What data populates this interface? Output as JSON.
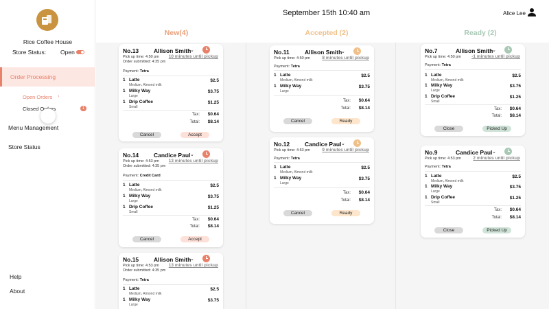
{
  "header": {
    "datetime": "September 15th 10:40 am",
    "user_name": "Alice Lee"
  },
  "sidebar": {
    "store_name": "Rice Coffee House",
    "store_status_label": "Store Status:",
    "store_status_value": "Open",
    "order_processing": "Order Processing",
    "open_orders": "Open Orders",
    "closed_orders": "Closed Orders",
    "closed_orders_count": "1",
    "menu_management": "Menu Management",
    "store_status": "Store Status",
    "help": "Help",
    "about": "About"
  },
  "columns": {
    "new": "New(4)",
    "accepted": "Accepted (2)",
    "ready": "Ready  (2)"
  },
  "colors": {
    "accent": "#e8826b",
    "new": "#e8a07a",
    "accepted": "#f0c08a",
    "ready": "#a9c9b6",
    "clock_new": "#e8826b",
    "clock_accepted": "#f0c08a",
    "clock_ready": "#a9c9b6"
  },
  "labels": {
    "tax": "Tax:",
    "total": "Total:",
    "cancel": "Cancel",
    "accept": "Accept",
    "ready": "Ready",
    "close": "Close",
    "picked_up": "Picked Up"
  },
  "orders": {
    "n13": {
      "number": "No.13",
      "customer": "Allison Smith",
      "pickup": "Pick up time: 4:50 pm",
      "submitted": "Order submitted: 4:35 pm",
      "until": "10 minutes until pickup",
      "payment_label": "Payment:",
      "payment": "Tetra",
      "items": [
        {
          "qty": "1",
          "name": "Latte",
          "mod": "Medium, Almond milk",
          "price": "$2.5"
        },
        {
          "qty": "1",
          "name": "Milky Way",
          "mod": "Large",
          "price": "$3.75"
        },
        {
          "qty": "1",
          "name": "Drip Coffee",
          "mod": "Small",
          "price": "$1.25"
        }
      ],
      "tax": "$0.64",
      "total": "$8.14"
    },
    "n14": {
      "number": "No.14",
      "customer": "Candice Paul",
      "pickup": "Pick up time: 4:53 pm",
      "submitted": "Order submitted: 4:35 pm",
      "until": "13 minutes until pickup",
      "payment_label": "Payment:",
      "payment": "Credit Card",
      "items": [
        {
          "qty": "1",
          "name": "Latte",
          "mod": "Medium, Almond milk",
          "price": "$2.5"
        },
        {
          "qty": "1",
          "name": "Milky Way",
          "mod": "Large",
          "price": "$3.75"
        },
        {
          "qty": "1",
          "name": "Drip Coffee",
          "mod": "Small",
          "price": "$1.25"
        }
      ],
      "tax": "$0.64",
      "total": "$8.14"
    },
    "n15": {
      "number": "No.15",
      "customer": "Allison Smith",
      "pickup": "Pick up time: 4:53 pm",
      "submitted": "Order submitted: 4:35 pm",
      "until": "13 minutes until pickup",
      "payment_label": "Payment:",
      "payment": "Tetra",
      "items": [
        {
          "qty": "1",
          "name": "Latte",
          "mod": "Medium, Almond milk",
          "price": "$2.5"
        },
        {
          "qty": "1",
          "name": "Milky Way",
          "mod": "Large",
          "price": "$3.75"
        }
      ]
    },
    "n11": {
      "number": "No.11",
      "customer": "Allison Smith",
      "pickup": "Pick up time: 4:50 pm",
      "until": "8 minutes until pickup",
      "payment_label": "Payment:",
      "payment": "Tetra",
      "items": [
        {
          "qty": "1",
          "name": "Latte",
          "mod": "Medium, Almond milk",
          "price": "$2.5"
        },
        {
          "qty": "1",
          "name": "Milky Way",
          "mod": "Large",
          "price": "$3.75"
        }
      ],
      "tax": "$0.64",
      "total": "$8.14"
    },
    "n12": {
      "number": "No.12",
      "customer": "Candice Paul",
      "pickup": "Pick up time: 4:53 pm",
      "until": "9 minutes until pickup",
      "payment_label": "Payment:",
      "payment": "Tetra",
      "items": [
        {
          "qty": "1",
          "name": "Latte",
          "mod": "Medium, Almond milk",
          "price": "$2.5"
        },
        {
          "qty": "1",
          "name": "Milky Way",
          "mod": "Large",
          "price": "$3.75"
        }
      ],
      "tax": "$0.64",
      "total": "$8.14"
    },
    "n7": {
      "number": "No.7",
      "customer": "Allison Smith",
      "pickup": "Pick up time: 4:50 pm",
      "until": "-1 minutes until pickup",
      "payment_label": "Payment:",
      "payment": "Tetra",
      "items": [
        {
          "qty": "1",
          "name": "Latte",
          "mod": "Medium, Almond milk",
          "price": "$2.5"
        },
        {
          "qty": "1",
          "name": "Milky Way",
          "mod": "Large",
          "price": "$3.75"
        },
        {
          "qty": "1",
          "name": "Drip Coffee",
          "mod": "Small",
          "price": "$1.25"
        }
      ],
      "tax": "$0.64",
      "total": "$8.14"
    },
    "n9": {
      "number": "No.9",
      "customer": "Candice Paul",
      "pickup": "Pick up time: 4:53 pm",
      "until": "2 minutes until pickup",
      "payment_label": "Payment:",
      "payment": "Tetra",
      "items": [
        {
          "qty": "1",
          "name": "Latte",
          "mod": "Medium, Almond milk",
          "price": "$2.5"
        },
        {
          "qty": "1",
          "name": "Milky Way",
          "mod": "Large",
          "price": "$3.75"
        },
        {
          "qty": "1",
          "name": "Drip Coffee",
          "mod": "Small",
          "price": "$1.25"
        }
      ],
      "tax": "$0.64",
      "total": "$8.14"
    }
  }
}
